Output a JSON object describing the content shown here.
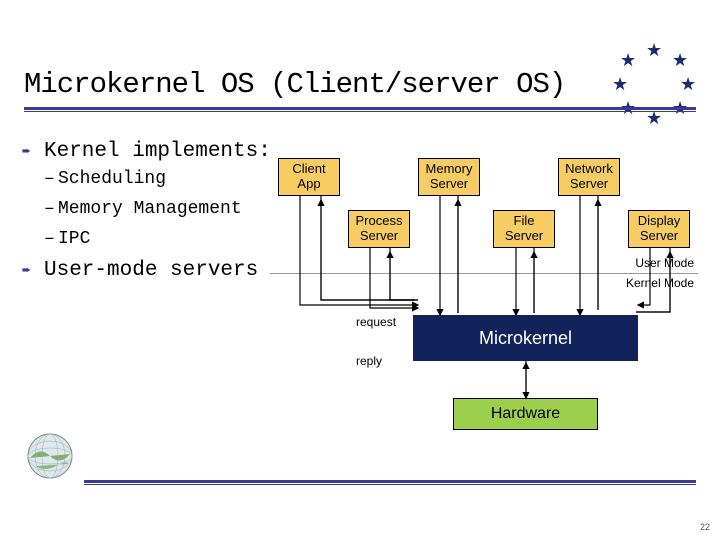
{
  "title": "Microkernel OS (Client/server OS)",
  "bullets": {
    "main1": "Kernel implements:",
    "sub1": "Scheduling",
    "sub2": "Memory Management",
    "sub3": "IPC",
    "main2": "User-mode servers"
  },
  "boxes": {
    "client_app": "Client\nApp",
    "memory_server": "Memory\nServer",
    "network_server": "Network\nServer",
    "process_server": "Process\nServer",
    "file_server": "File\nServer",
    "display_server": "Display\nServer",
    "microkernel": "Microkernel",
    "hardware": "Hardware"
  },
  "labels": {
    "user_mode": "User Mode",
    "kernel_mode": "Kernel Mode",
    "request": "request",
    "reply": "reply"
  },
  "page_number": "22"
}
